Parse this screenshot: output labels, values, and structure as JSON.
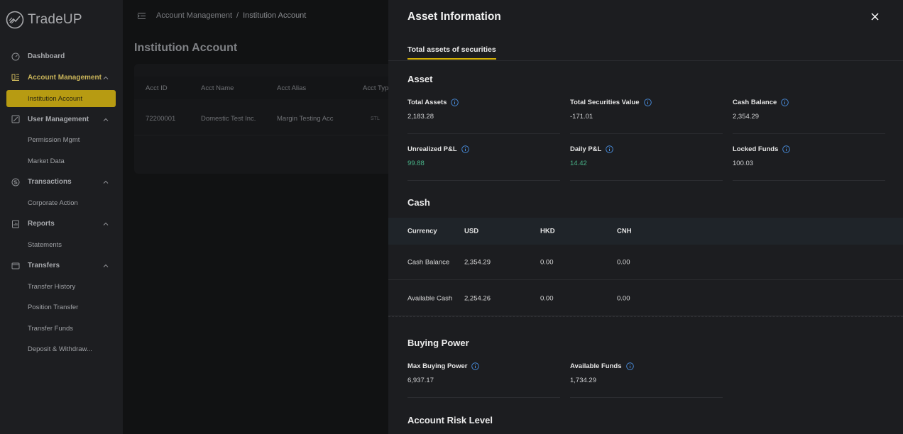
{
  "app": {
    "name": "TradeUP"
  },
  "sidebar": {
    "items": [
      {
        "label": "Dashboard",
        "icon": "dashboard-icon",
        "type": "section"
      },
      {
        "label": "Account Management",
        "icon": "account-icon",
        "type": "section",
        "open": true
      },
      {
        "label": "Institution Account",
        "type": "sub",
        "active": true
      },
      {
        "label": "User Management",
        "icon": "user-edit-icon",
        "type": "section"
      },
      {
        "label": "Permission Mgmt",
        "type": "sub"
      },
      {
        "label": "Market Data",
        "type": "sub"
      },
      {
        "label": "Transactions",
        "icon": "coin-icon",
        "type": "section"
      },
      {
        "label": "Corporate Action",
        "type": "sub"
      },
      {
        "label": "Reports",
        "icon": "report-icon",
        "type": "section"
      },
      {
        "label": "Statements",
        "type": "sub"
      },
      {
        "label": "Transfers",
        "icon": "wallet-icon",
        "type": "section"
      },
      {
        "label": "Transfer History",
        "type": "sub"
      },
      {
        "label": "Position Transfer",
        "type": "sub"
      },
      {
        "label": "Transfer Funds",
        "type": "sub"
      },
      {
        "label": "Deposit & Withdraw...",
        "type": "sub"
      }
    ]
  },
  "header": {
    "breadcrumb": [
      "Account Management",
      "Institution Account"
    ],
    "separator": "/"
  },
  "main": {
    "title": "Institution Account",
    "table": {
      "columns": [
        "Acct ID",
        "Acct Name",
        "Acct Alias",
        "Acct Typ"
      ],
      "rows": [
        [
          "72200001",
          "Domestic Test Inc.",
          "Margin Testing Acc",
          "STL"
        ]
      ]
    }
  },
  "drawer": {
    "title": "Asset Information",
    "tab": "Total assets of securities",
    "asset": {
      "title": "Asset",
      "metrics": [
        {
          "label": "Total Assets",
          "value": "2,183.28"
        },
        {
          "label": "Total Securities Value",
          "value": "-171.01"
        },
        {
          "label": "Cash Balance",
          "value": "2,354.29"
        },
        {
          "label": "Unrealized P&L",
          "value": "99.88",
          "color": "#49b58a"
        },
        {
          "label": "Daily P&L",
          "value": "14.42",
          "color": "#49b58a"
        },
        {
          "label": "Locked Funds",
          "value": "100.03"
        }
      ]
    },
    "cash": {
      "title": "Cash",
      "columns": [
        "Currency",
        "USD",
        "HKD",
        "CNH"
      ],
      "rows": [
        [
          "Cash Balance",
          "2,354.29",
          "0.00",
          "0.00"
        ],
        [
          "Available Cash",
          "2,254.26",
          "0.00",
          "0.00"
        ]
      ]
    },
    "buying_power": {
      "title": "Buying Power",
      "metrics": [
        {
          "label": "Max Buying Power",
          "value": "6,937.17"
        },
        {
          "label": "Available Funds",
          "value": "1,734.29"
        }
      ]
    },
    "risk": {
      "title": "Account Risk Level"
    }
  },
  "colors": {
    "accent": "#d4b106",
    "active_nav": "#b79b12",
    "positive": "#49b58a",
    "info_icon": "#4a90e2"
  }
}
